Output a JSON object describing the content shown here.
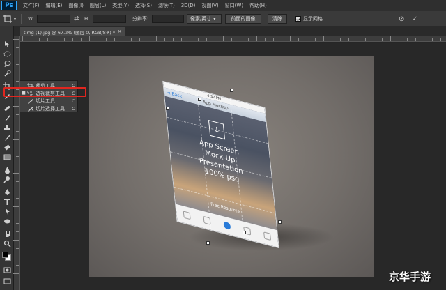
{
  "app": {
    "logo": "Ps"
  },
  "menu": [
    "文件(F)",
    "编辑(E)",
    "图像(I)",
    "图层(L)",
    "类型(Y)",
    "选择(S)",
    "滤镜(T)",
    "3D(D)",
    "视图(V)",
    "窗口(W)",
    "帮助(H)"
  ],
  "options": {
    "w_label": "W:",
    "h_label": "H:",
    "resolution_label": "分辨率:",
    "unit_select": "像素/英寸",
    "front_image_button": "前面的图像",
    "clear_button": "清除",
    "show_grid_label": "显示网格",
    "show_grid_checked": true
  },
  "document": {
    "tab_title": "timg (1).jpg @ 67.2% (图层 0, RGB/8#) *"
  },
  "flyout": {
    "items": [
      {
        "label": "裁剪工具",
        "shortcut": "C",
        "selected": false,
        "icon": "crop-icon"
      },
      {
        "label": "透视裁剪工具",
        "shortcut": "C",
        "selected": true,
        "icon": "perspective-crop-icon"
      },
      {
        "label": "切片工具",
        "shortcut": "C",
        "selected": false,
        "icon": "slice-icon"
      },
      {
        "label": "切片选择工具",
        "shortcut": "C",
        "selected": false,
        "icon": "slice-select-icon"
      }
    ]
  },
  "phone": {
    "time": "4:37 PM",
    "nav_back": "< Back",
    "nav_title": "App Mockup",
    "line1": "App Screen",
    "line2": "Mock-Up",
    "line3": "Presentation",
    "line4": "100% psd",
    "free": "Free Resource"
  },
  "watermark": "京华手游",
  "colors": {
    "highlight": "#e0261f",
    "ps_blue": "#31a8ff",
    "ios_blue": "#2a7bd8"
  }
}
